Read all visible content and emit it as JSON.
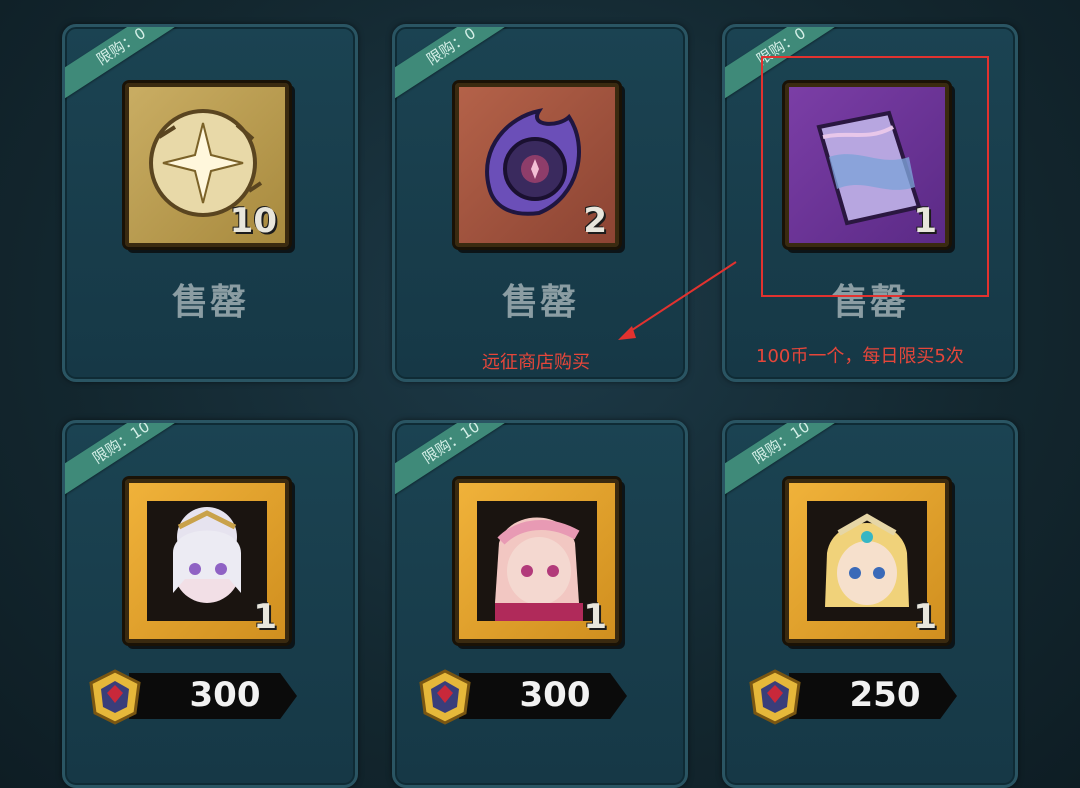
{
  "shop": {
    "cards": [
      {
        "limit": "限购：0",
        "quantity": "10",
        "sold_label": "售罄",
        "item_icon": "gold-rune-shard-icon",
        "frame": "gold"
      },
      {
        "limit": "限购：0",
        "quantity": "2",
        "sold_label": "售罄",
        "item_icon": "dark-flame-orb-icon",
        "frame": "red"
      },
      {
        "limit": "限购：0",
        "quantity": "1",
        "sold_label": "售罄",
        "item_icon": "purple-scroll-icon",
        "frame": "purple"
      },
      {
        "limit": "限购：10",
        "quantity": "1",
        "price": "300",
        "item_icon": "hero-white-hair-portrait-icon",
        "frame": "hero",
        "currency_icon": "expedition-coin-icon"
      },
      {
        "limit": "限购：10",
        "quantity": "1",
        "price": "300",
        "item_icon": "hero-pink-hair-portrait-icon",
        "frame": "hero",
        "currency_icon": "expedition-coin-icon"
      },
      {
        "limit": "限购：10",
        "quantity": "1",
        "price": "250",
        "item_icon": "hero-blonde-tiara-portrait-icon",
        "frame": "hero",
        "currency_icon": "expedition-coin-icon"
      }
    ]
  },
  "annotations": {
    "note_expedition": "远征商店购买",
    "note_price": "100币一个，每日限买5次",
    "color": "#e2322f"
  }
}
